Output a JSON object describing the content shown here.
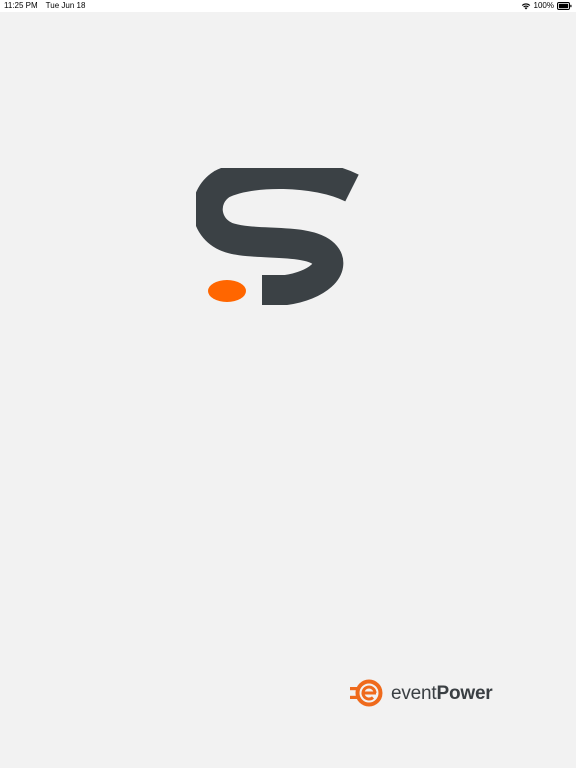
{
  "status_bar": {
    "time": "11:25 PM",
    "date": "Tue Jun 18",
    "battery": "100%",
    "icons": [
      "wifi-icon",
      "battery-icon"
    ]
  },
  "splash": {
    "logo_letter": "S",
    "colors": {
      "background": "#f2f2f2",
      "logo_dark": "#3b4145",
      "logo_accent": "#ff6600"
    }
  },
  "brand": {
    "word_part1": "event",
    "word_part2": "Power",
    "colors": {
      "mark": "#ef6a1c",
      "text": "#3a3f43"
    }
  }
}
